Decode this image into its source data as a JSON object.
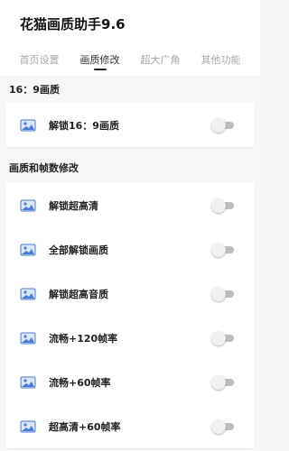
{
  "app": {
    "title": "花猫画质助手9.6"
  },
  "tabs": [
    {
      "label": "首页设置",
      "active": false
    },
    {
      "label": "画质修改",
      "active": true
    },
    {
      "label": "超大广角",
      "active": false
    },
    {
      "label": "其他功能",
      "active": false
    }
  ],
  "sections": [
    {
      "title": "16：9画质",
      "items": [
        {
          "label": "解锁16：9画质",
          "enabled": false
        }
      ]
    },
    {
      "title": "画质和帧数修改",
      "items": [
        {
          "label": "解锁超高清",
          "enabled": false
        },
        {
          "label": "全部解锁画质",
          "enabled": false
        },
        {
          "label": "解锁超高音质",
          "enabled": false
        },
        {
          "label": "流畅+120帧率",
          "enabled": false
        },
        {
          "label": "流畅+60帧率",
          "enabled": false
        },
        {
          "label": "超高清+60帧率",
          "enabled": false
        }
      ]
    }
  ],
  "colors": {
    "icon_blue": "#4a7bd6",
    "toggle_track": "#bdbdbd",
    "toggle_knob": "#f1f1f1"
  },
  "icons": {
    "item_icon": "image-icon"
  }
}
